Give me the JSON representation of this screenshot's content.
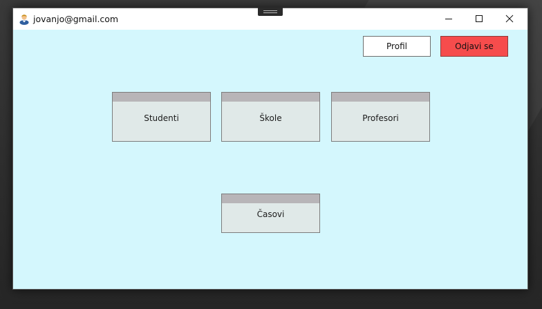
{
  "window": {
    "title": "jovanjo@gmail.com",
    "icon": "user-avatar-icon",
    "controls": [
      "minimize-icon",
      "maximize-icon",
      "close-icon"
    ]
  },
  "header": {
    "profile_label": "Profil",
    "logout_label": "Odjavi se"
  },
  "tiles": [
    {
      "label": "Studenti"
    },
    {
      "label": "Škole"
    },
    {
      "label": "Profesori"
    },
    {
      "label": "Časovi"
    }
  ],
  "colors": {
    "client_background": "#d4f7fd",
    "logout_button": "#f64c4c",
    "tile_face": "#e0e9e8",
    "tile_strip": "#b8b5b8"
  }
}
